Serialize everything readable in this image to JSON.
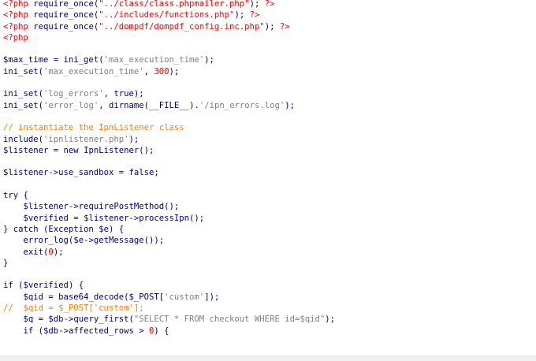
{
  "lines": [
    [
      {
        "t": "<?php ",
        "c": "tag"
      },
      {
        "t": "require_once",
        "c": "kw"
      },
      {
        "t": "(",
        "c": "plain"
      },
      {
        "t": "\"../class/class.phpmailer.php\"",
        "c": "tag"
      },
      {
        "t": "); ",
        "c": "plain"
      },
      {
        "t": "?>",
        "c": "tag"
      }
    ],
    [
      {
        "t": "<?php ",
        "c": "tag"
      },
      {
        "t": "require_once",
        "c": "kw"
      },
      {
        "t": "(",
        "c": "plain"
      },
      {
        "t": "\"../includes/functions.php\"",
        "c": "tag"
      },
      {
        "t": "); ",
        "c": "plain"
      },
      {
        "t": "?>",
        "c": "tag"
      }
    ],
    [
      {
        "t": "<?php ",
        "c": "tag"
      },
      {
        "t": "require_once",
        "c": "kw"
      },
      {
        "t": "(",
        "c": "plain"
      },
      {
        "t": "\"../dompdf/dompdf_config.inc.php\"",
        "c": "tag"
      },
      {
        "t": "); ",
        "c": "plain"
      },
      {
        "t": "?>",
        "c": "tag"
      }
    ],
    [
      {
        "t": "<?php",
        "c": "tag"
      }
    ],
    [],
    [
      {
        "t": "$max_time",
        "c": "var"
      },
      {
        "t": " = ",
        "c": "plain"
      },
      {
        "t": "ini_get",
        "c": "fn"
      },
      {
        "t": "(",
        "c": "plain"
      },
      {
        "t": "'max_execution_time'",
        "c": "str"
      },
      {
        "t": ");",
        "c": "plain"
      }
    ],
    [
      {
        "t": "ini_set",
        "c": "fn"
      },
      {
        "t": "(",
        "c": "plain"
      },
      {
        "t": "'max_execution_time'",
        "c": "str"
      },
      {
        "t": ", ",
        "c": "plain"
      },
      {
        "t": "300",
        "c": "num"
      },
      {
        "t": ");",
        "c": "plain"
      }
    ],
    [],
    [
      {
        "t": "ini_set",
        "c": "fn"
      },
      {
        "t": "(",
        "c": "plain"
      },
      {
        "t": "'log_errors'",
        "c": "str"
      },
      {
        "t": ", ",
        "c": "plain"
      },
      {
        "t": "true",
        "c": "kw"
      },
      {
        "t": ");",
        "c": "plain"
      }
    ],
    [
      {
        "t": "ini_set",
        "c": "fn"
      },
      {
        "t": "(",
        "c": "plain"
      },
      {
        "t": "'error_log'",
        "c": "str"
      },
      {
        "t": ", ",
        "c": "plain"
      },
      {
        "t": "dirname",
        "c": "fn"
      },
      {
        "t": "(",
        "c": "plain"
      },
      {
        "t": "__FILE__",
        "c": "kw"
      },
      {
        "t": ").",
        "c": "plain"
      },
      {
        "t": "'/ipn_errors.log'",
        "c": "str"
      },
      {
        "t": ");",
        "c": "plain"
      }
    ],
    [],
    [
      {
        "t": "// instantiate the IpnListener class",
        "c": "com"
      }
    ],
    [
      {
        "t": "include",
        "c": "kw"
      },
      {
        "t": "(",
        "c": "plain"
      },
      {
        "t": "'ipnlistener.php'",
        "c": "str"
      },
      {
        "t": ");",
        "c": "plain"
      }
    ],
    [
      {
        "t": "$listener",
        "c": "var"
      },
      {
        "t": " = ",
        "c": "plain"
      },
      {
        "t": "new",
        "c": "kw"
      },
      {
        "t": " IpnListener();",
        "c": "plain"
      }
    ],
    [],
    [
      {
        "t": "$listener",
        "c": "var"
      },
      {
        "t": "->use_sandbox = ",
        "c": "plain"
      },
      {
        "t": "false",
        "c": "kw"
      },
      {
        "t": ";",
        "c": "plain"
      }
    ],
    [],
    [
      {
        "t": "try",
        "c": "kw"
      },
      {
        "t": " {",
        "c": "plain"
      }
    ],
    [
      {
        "t": "    ",
        "c": "plain"
      },
      {
        "t": "$listener",
        "c": "var"
      },
      {
        "t": "->requirePostMethod();",
        "c": "plain"
      }
    ],
    [
      {
        "t": "    ",
        "c": "plain"
      },
      {
        "t": "$verified",
        "c": "var"
      },
      {
        "t": " = ",
        "c": "plain"
      },
      {
        "t": "$listener",
        "c": "var"
      },
      {
        "t": "->processIpn();",
        "c": "plain"
      }
    ],
    [
      {
        "t": "} ",
        "c": "plain"
      },
      {
        "t": "catch",
        "c": "kw"
      },
      {
        "t": " (Exception ",
        "c": "plain"
      },
      {
        "t": "$e",
        "c": "var"
      },
      {
        "t": ") {",
        "c": "plain"
      }
    ],
    [
      {
        "t": "    ",
        "c": "plain"
      },
      {
        "t": "error_log",
        "c": "fn"
      },
      {
        "t": "(",
        "c": "plain"
      },
      {
        "t": "$e",
        "c": "var"
      },
      {
        "t": "->getMessage());",
        "c": "plain"
      }
    ],
    [
      {
        "t": "    ",
        "c": "plain"
      },
      {
        "t": "exit",
        "c": "kw"
      },
      {
        "t": "(",
        "c": "plain"
      },
      {
        "t": "0",
        "c": "num"
      },
      {
        "t": ");",
        "c": "plain"
      }
    ],
    [
      {
        "t": "}",
        "c": "plain"
      }
    ],
    [],
    [
      {
        "t": "if",
        "c": "kw"
      },
      {
        "t": " (",
        "c": "plain"
      },
      {
        "t": "$verified",
        "c": "var"
      },
      {
        "t": ") {",
        "c": "plain"
      }
    ],
    [
      {
        "t": "    ",
        "c": "plain"
      },
      {
        "t": "$qid",
        "c": "var"
      },
      {
        "t": " = ",
        "c": "plain"
      },
      {
        "t": "base64_decode",
        "c": "fn"
      },
      {
        "t": "(",
        "c": "plain"
      },
      {
        "t": "$_POST",
        "c": "var"
      },
      {
        "t": "[",
        "c": "plain"
      },
      {
        "t": "'custom'",
        "c": "str"
      },
      {
        "t": "]);",
        "c": "plain"
      }
    ],
    [
      {
        "t": "//  $qid = $_POST['custom'];",
        "c": "com"
      }
    ],
    [
      {
        "t": "    ",
        "c": "plain"
      },
      {
        "t": "$q",
        "c": "var"
      },
      {
        "t": " = ",
        "c": "plain"
      },
      {
        "t": "$db",
        "c": "var"
      },
      {
        "t": "->query_first(",
        "c": "plain"
      },
      {
        "t": "\"SELECT * FROM checkout WHERE id=$qid\"",
        "c": "str"
      },
      {
        "t": ");",
        "c": "plain"
      }
    ],
    [
      {
        "t": "    ",
        "c": "plain"
      },
      {
        "t": "if",
        "c": "kw"
      },
      {
        "t": " (",
        "c": "plain"
      },
      {
        "t": "$db",
        "c": "var"
      },
      {
        "t": "->affected_rows > ",
        "c": "plain"
      },
      {
        "t": "0",
        "c": "num"
      },
      {
        "t": ") {",
        "c": "plain"
      }
    ]
  ]
}
